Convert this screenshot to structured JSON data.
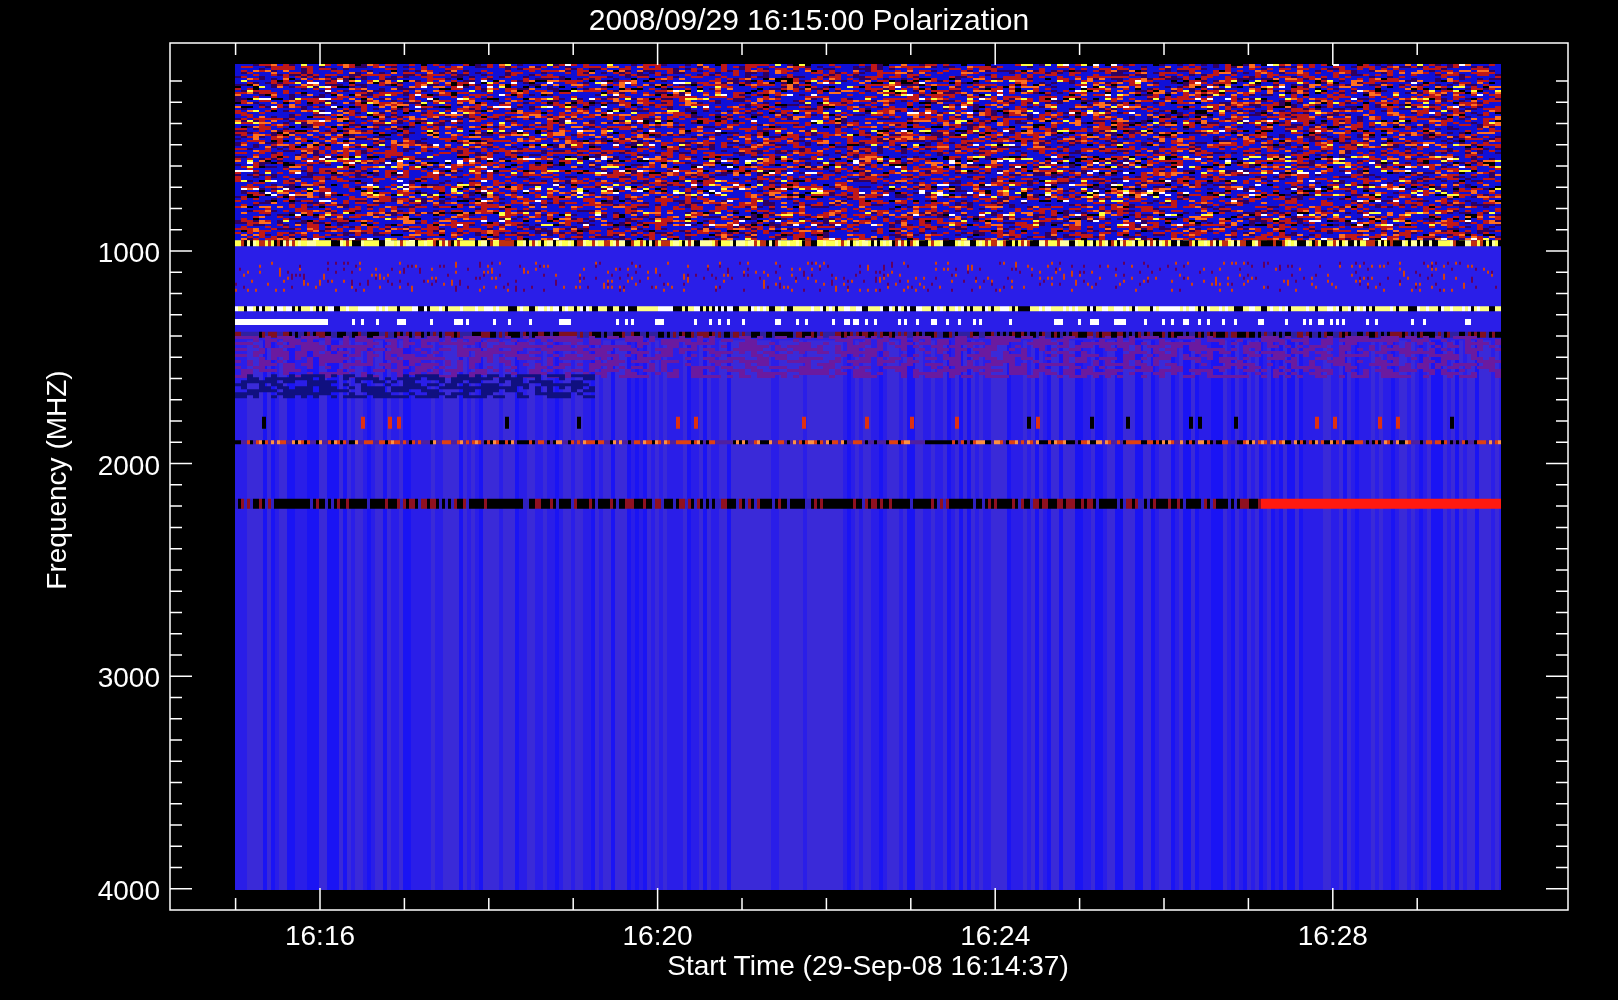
{
  "title": "2008/09/29 16:15:00 Polarization",
  "x_axis": {
    "label": "Start Time (29-Sep-08 16:14:37)",
    "ticks": [
      "16:16",
      "16:20",
      "16:24",
      "16:28"
    ]
  },
  "y_axis": {
    "label": "Frequency (MHZ)",
    "ticks": [
      "1000",
      "2000",
      "3000",
      "4000"
    ]
  }
}
